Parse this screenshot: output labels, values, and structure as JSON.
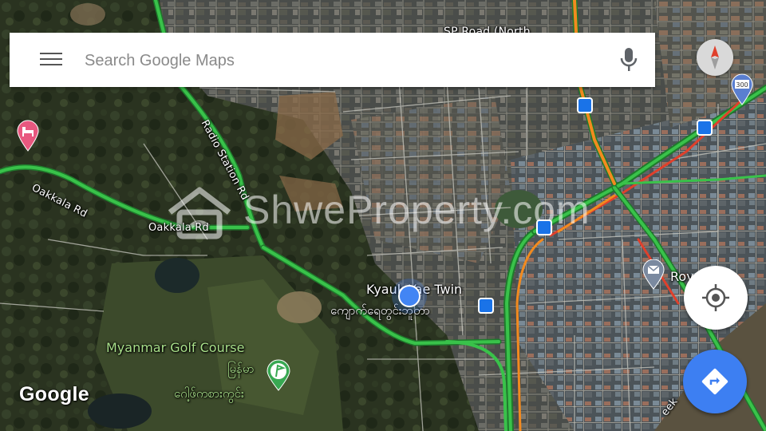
{
  "search": {
    "placeholder": "Search Google Maps"
  },
  "watermark": {
    "text": "ShweProperty.com"
  },
  "branding": {
    "google": "Google"
  },
  "roads": {
    "oakkala_rd_1": "Oakkala Rd",
    "oakkala_rd_2": "Oakkala Rd",
    "radio_station_rd": "Radio Station Rd",
    "top_partial": "SP Road (North",
    "bottom_partial": "eek"
  },
  "places": {
    "kyauk_yae_twin_en": "Kyauk Yae Twin",
    "kyauk_yae_twin_my": "ကျောက်ရေတွင်းဘူတာ",
    "golf_course_en": "Myanmar Golf Course",
    "golf_course_my_1": "မြန်မာ",
    "golf_course_my_2": "ဂေါ့ဖ်ကစားကွင်း",
    "post_office_partial": "Roy        ress",
    "highway_shield": "300"
  },
  "icons": {
    "menu": "menu-icon",
    "mic": "mic-icon",
    "compass": "compass-icon",
    "locate": "my-location-icon",
    "directions": "directions-icon",
    "hotel": "hotel-pin-icon",
    "golf": "golf-icon",
    "bus": "bus-station-icon",
    "mail": "mail-pin-icon",
    "user_location": "user-location-dot"
  },
  "colors": {
    "traffic_green": "#39c24a",
    "traffic_orange": "#f28a1f",
    "traffic_red": "#e0402c",
    "accent_blue": "#3d7ff2",
    "location_blue": "#4285f4",
    "hotel_pink": "#e8587f"
  }
}
